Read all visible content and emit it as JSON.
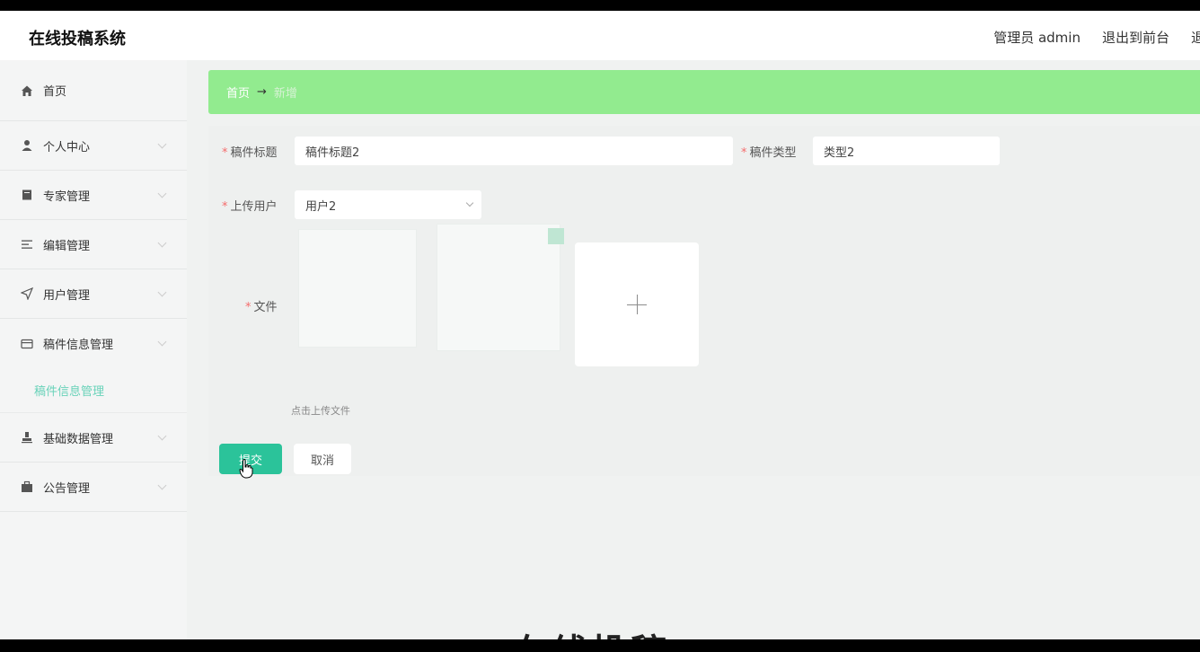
{
  "header": {
    "title": "在线投稿系统",
    "user_label": "管理员 admin",
    "front_link": "退出到前台",
    "logout_link": "退"
  },
  "sidebar": {
    "items": [
      {
        "label": "首页",
        "icon": "home-icon"
      },
      {
        "label": "个人中心",
        "icon": "user-icon"
      },
      {
        "label": "专家管理",
        "icon": "book-icon"
      },
      {
        "label": "编辑管理",
        "icon": "list-icon"
      },
      {
        "label": "用户管理",
        "icon": "send-icon"
      },
      {
        "label": "稿件信息管理",
        "icon": "card-icon"
      },
      {
        "label": "基础数据管理",
        "icon": "stamp-icon"
      },
      {
        "label": "公告管理",
        "icon": "briefcase-icon"
      }
    ],
    "submenu_active": "稿件信息管理"
  },
  "breadcrumb": {
    "home": "首页",
    "separator": "→",
    "current": "新增"
  },
  "form": {
    "title_label": "稿件标题",
    "title_value": "稿件标题2",
    "type_label": "稿件类型",
    "type_value": "类型2",
    "user_label": "上传用户",
    "user_value": "用户2",
    "file_label": "文件",
    "upload_hint": "点击上传文件",
    "submit_label": "提交",
    "cancel_label": "取消"
  },
  "footer_overlay": "在线投稿"
}
